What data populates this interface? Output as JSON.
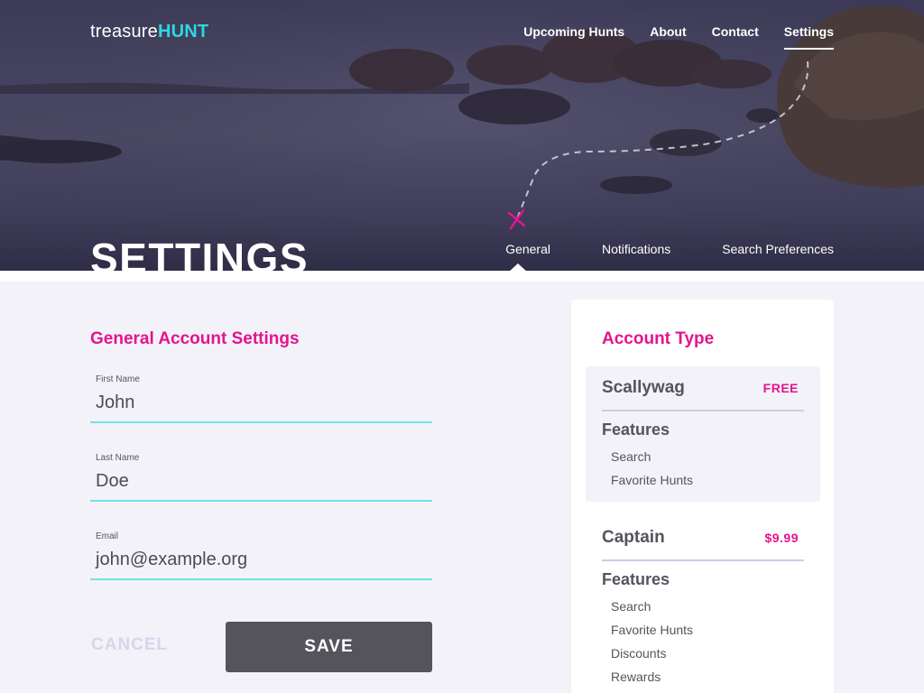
{
  "brand": {
    "prefix": "treasure",
    "suffix": "HUNT"
  },
  "nav": {
    "items": [
      {
        "label": "Upcoming Hunts",
        "active": false
      },
      {
        "label": "About",
        "active": false
      },
      {
        "label": "Contact",
        "active": false
      },
      {
        "label": "Settings",
        "active": true
      }
    ]
  },
  "page": {
    "title": "SETTINGS"
  },
  "tabs": {
    "items": [
      {
        "label": "General",
        "active": true
      },
      {
        "label": "Notifications",
        "active": false
      },
      {
        "label": "Search Preferences",
        "active": false
      }
    ]
  },
  "form": {
    "heading": "General Account Settings",
    "fields": [
      {
        "label": "First Name",
        "value": "John"
      },
      {
        "label": "Last Name",
        "value": "Doe"
      },
      {
        "label": "Email",
        "value": "john@example.org"
      }
    ],
    "cancel_label": "CANCEL",
    "save_label": "SAVE"
  },
  "account": {
    "heading": "Account Type",
    "plans": [
      {
        "name": "Scallywag",
        "price": "FREE",
        "selected": true,
        "features_title": "Features",
        "features": [
          "Search",
          "Favorite Hunts"
        ]
      },
      {
        "name": "Captain",
        "price": "$9.99",
        "selected": false,
        "features_title": "Features",
        "features": [
          "Search",
          "Favorite Hunts",
          "Discounts",
          "Rewards"
        ]
      }
    ]
  },
  "colors": {
    "accent_pink": "#e3148e",
    "accent_cyan": "#2ed8e3",
    "input_underline": "#6fe2ea",
    "save_button": "#55545c",
    "background": "#f3f2f8"
  },
  "icons": {
    "map_marker": "x-mark-icon",
    "route": "dashed-trail"
  }
}
